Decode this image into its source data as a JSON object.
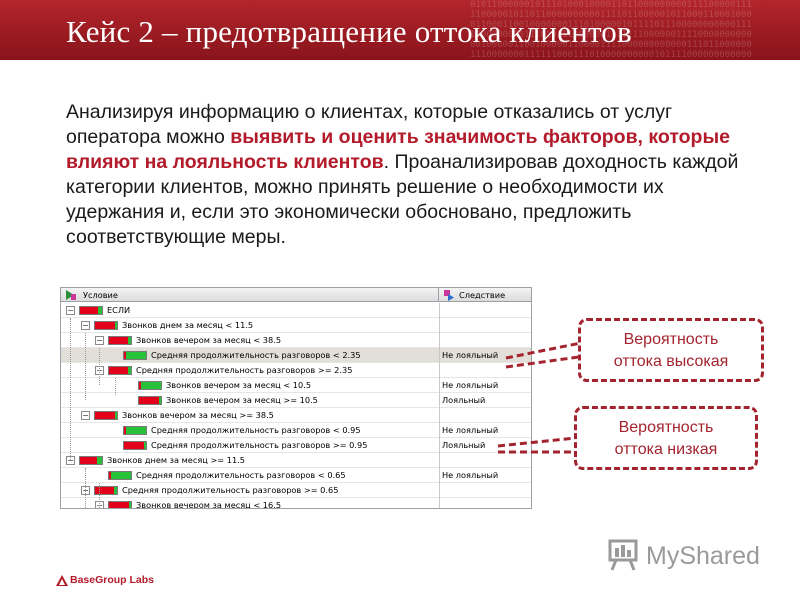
{
  "slide": {
    "title": "Кейс 2 – предотвращение оттока клиентов",
    "binary_text": "0101100000010111010001000011011000000000111100000111\n1100000101101100000000001111011000001011000110001000\n0110001100100000001110100000101111011100000000000111\n1000000000111010111000000111111100000011110000000000\n0010000011001000001100001111000000000000111011000000\n1110000000111111000111010000000000101111000000000000"
  },
  "intro": {
    "part1": "Анализируя информацию о клиентах, которые отказались от услуг оператора можно ",
    "highlight": "выявить и оценить значимость факторов, которые влияют на лояльность клиентов",
    "part2": ". Проанализировав доходность каждой категории клиентов, можно принять решение о необходимости их удержания и, если это экономически обосновано, предложить соответствующие меры."
  },
  "tree": {
    "header": {
      "condition_label": "Условие",
      "result_label": "Следствие"
    },
    "rows": [
      {
        "label": "ЕСЛИ",
        "result": "",
        "green": 0.2,
        "selected": false
      },
      {
        "label": "Звонков днем за месяц < 11.5",
        "result": "",
        "green": 0.1,
        "selected": false
      },
      {
        "label": "Звонков вечером за месяц < 38.5",
        "result": "",
        "green": 0.15,
        "selected": false
      },
      {
        "label": "Средняя продолжительность разговоров < 2.35",
        "result": "Не лояльный",
        "green": 0.92,
        "selected": true
      },
      {
        "label": "Средняя продолжительность разговоров >= 2.35",
        "result": "",
        "green": 0.12,
        "selected": false
      },
      {
        "label": "Звонков вечером за месяц < 10.5",
        "result": "Не лояльный",
        "green": 0.92,
        "selected": false
      },
      {
        "label": "Звонков вечером за месяц >= 10.5",
        "result": "Лояльный",
        "green": 0.08,
        "selected": false
      },
      {
        "label": "Звонков вечером за месяц >= 38.5",
        "result": "",
        "green": 0.1,
        "selected": false
      },
      {
        "label": "Средняя продолжительность разговоров < 0.95",
        "result": "Не лояльный",
        "green": 0.92,
        "selected": false
      },
      {
        "label": "Средняя продолжительность разговоров >= 0.95",
        "result": "Лояльный",
        "green": 0.08,
        "selected": false
      },
      {
        "label": "Звонков днем за месяц >= 11.5",
        "result": "",
        "green": 0.25,
        "selected": false
      },
      {
        "label": "Средняя продолжительность разговоров < 0.65",
        "result": "Не лояльный",
        "green": 0.92,
        "selected": false
      },
      {
        "label": "Средняя продолжительность разговоров >= 0.65",
        "result": "",
        "green": 0.12,
        "selected": false
      },
      {
        "label": "Звонков вечером за месяц < 16.5",
        "result": "",
        "green": 0.1,
        "selected": false
      }
    ]
  },
  "callouts": {
    "high": {
      "line1": "Вероятность",
      "line2": "оттока высокая"
    },
    "low": {
      "line1": "Вероятность",
      "line2": "оттока низкая"
    }
  },
  "footer": {
    "logo_text": "BaseGroup Labs"
  },
  "watermark": {
    "text": "MyShared"
  },
  "colors": {
    "header_red": "#9b1b22",
    "accent_red": "#b31b2a",
    "callout_red": "#a3242e",
    "bar_red": "#e3001b",
    "bar_green": "#27c13a",
    "selected_row": "#e2ded8"
  }
}
